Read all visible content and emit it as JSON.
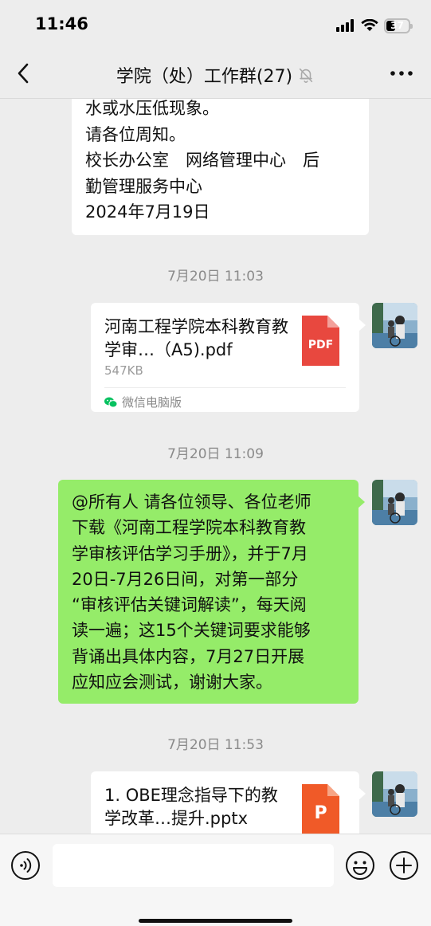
{
  "status": {
    "time": "11:46",
    "battery": "37",
    "battery_level": 0.37
  },
  "nav": {
    "title": "学院（处）工作群(27)",
    "back_icon": "chevron-left-icon",
    "muted_icon": "bell-off-icon",
    "more_icon": "ellipsis-icon"
  },
  "messages": {
    "prev_text": {
      "lines": [
        "水或水压低现象。",
        "请各位周知。",
        "校长办公室　网络管理中心　后",
        "勤管理服务中心",
        "2024年7月19日"
      ]
    },
    "ts1": "7月20日 11:03",
    "file1": {
      "name": "河南工程学院本科教育教学审…（A5).pdf",
      "size": "547KB",
      "source": "微信电脑版",
      "type_label": "PDF"
    },
    "ts2": "7月20日 11:09",
    "text2": {
      "lines": [
        "@所有人 请各位领导、各位老师",
        "下载《河南工程学院本科教育教",
        "学审核评估学习手册》，并于7月",
        "20日-7月26日间，对第一部分",
        "“审核评估关键词解读”，每天阅",
        "读一遍；这15个关键词要求能够",
        "背诵出具体内容，7月27日开展",
        "应知应会测试，谢谢大家。"
      ]
    },
    "ts3": "7月20日 11:53",
    "file2": {
      "name": "1. OBE理念指导下的教学改革…提升.pptx",
      "type_label": "P"
    }
  },
  "input": {
    "voice_icon": "voice-icon",
    "emoji_icon": "emoji-icon",
    "plus_icon": "plus-icon",
    "value": ""
  },
  "colors": {
    "background": "#ededed",
    "bubble_green": "#95ec69",
    "pdf_red": "#e8483f",
    "ppt_orange": "#f05a28",
    "wechat_green": "#07c160"
  }
}
